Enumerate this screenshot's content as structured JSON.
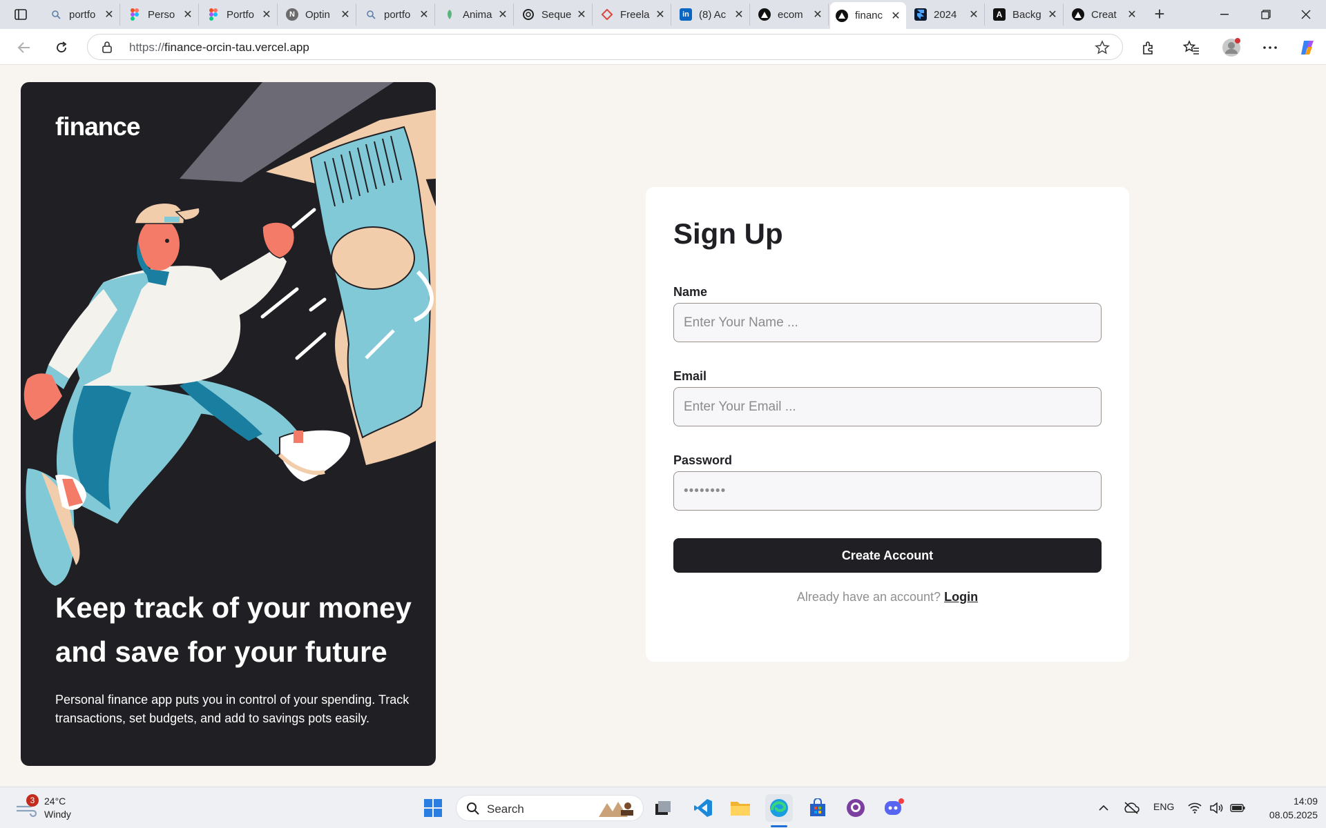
{
  "browser": {
    "tabs": [
      {
        "title": "portfo",
        "icon": "search-icon"
      },
      {
        "title": "Perso",
        "icon": "figma-icon"
      },
      {
        "title": "Portfo",
        "icon": "figma-icon"
      },
      {
        "title": "Optin",
        "icon": "notion-icon"
      },
      {
        "title": "portfo",
        "icon": "search-icon"
      },
      {
        "title": "Anima",
        "icon": "anima-icon"
      },
      {
        "title": "Seque",
        "icon": "openai-icon"
      },
      {
        "title": "Freela",
        "icon": "freelancer-icon"
      },
      {
        "title": "(8) Ac",
        "icon": "linkedin-icon"
      },
      {
        "title": "ecom",
        "icon": "vercel-icon"
      },
      {
        "title": "financ",
        "icon": "vercel-icon",
        "active": true
      },
      {
        "title": "2024",
        "icon": "framer-icon"
      },
      {
        "title": "Backg",
        "icon": "app-icon"
      },
      {
        "title": "Creat",
        "icon": "vercel-icon"
      }
    ],
    "url_prefix": "https://",
    "url_host": "finance-orcin-tau.vercel.app"
  },
  "hero": {
    "logo": "finance",
    "headline": "Keep track of your money and save for your future",
    "description": "Personal finance app puts you in control of your spending. Track transactions, set budgets, and add to savings pots easily."
  },
  "form": {
    "title": "Sign Up",
    "name_label": "Name",
    "name_placeholder": "Enter Your Name ...",
    "email_label": "Email",
    "email_placeholder": "Enter Your Email ...",
    "password_label": "Password",
    "password_value": "••••••••",
    "submit_label": "Create Account",
    "switch_text": "Already have an account?",
    "switch_link": "Login"
  },
  "taskbar": {
    "weather_temp": "24°C",
    "weather_cond": "Windy",
    "weather_badge": "3",
    "search_label": "Search",
    "lang": "ENG",
    "time": "14:09",
    "date": "08.05.2025"
  },
  "colors": {
    "accent_dark": "#201f24",
    "page_bg": "#f8f4ef",
    "illustration_blue": "#82c9d7",
    "illustration_peach": "#f2cdac"
  }
}
